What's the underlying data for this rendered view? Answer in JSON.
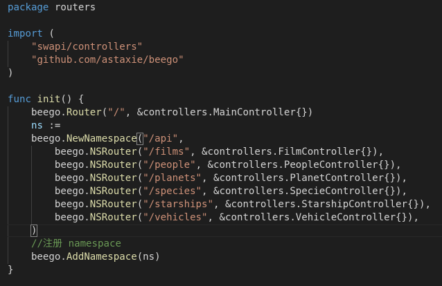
{
  "editor": {
    "lines": [
      [
        {
          "t": "package",
          "c": "kw"
        },
        {
          "t": " routers",
          "c": "plain"
        }
      ],
      [],
      [
        {
          "t": "import",
          "c": "kw"
        },
        {
          "t": " (",
          "c": "plain"
        }
      ],
      [
        {
          "t": "    ",
          "c": "plain"
        },
        {
          "t": "\"swapi/controllers\"",
          "c": "str"
        }
      ],
      [
        {
          "t": "    ",
          "c": "plain"
        },
        {
          "t": "\"github.com/astaxie/beego\"",
          "c": "str"
        }
      ],
      [
        {
          "t": ")",
          "c": "plain"
        }
      ],
      [],
      [
        {
          "t": "func",
          "c": "kw"
        },
        {
          "t": " ",
          "c": "plain"
        },
        {
          "t": "init",
          "c": "fn"
        },
        {
          "t": "() {",
          "c": "plain"
        }
      ],
      [
        {
          "t": "    beego.",
          "c": "plain"
        },
        {
          "t": "Router",
          "c": "fn"
        },
        {
          "t": "(",
          "c": "plain"
        },
        {
          "t": "\"/\"",
          "c": "str"
        },
        {
          "t": ", &controllers.MainController{})",
          "c": "plain"
        }
      ],
      [
        {
          "t": "    ",
          "c": "plain"
        },
        {
          "t": "ns",
          "c": "var"
        },
        {
          "t": " :=",
          "c": "plain"
        }
      ],
      [
        {
          "t": "    beego.",
          "c": "plain"
        },
        {
          "t": "NewNamespace",
          "c": "fn"
        },
        {
          "t": "(",
          "c": "plain",
          "m": true
        },
        {
          "t": "\"/api\"",
          "c": "str"
        },
        {
          "t": ",",
          "c": "plain"
        }
      ],
      [
        {
          "t": "        beego.",
          "c": "plain"
        },
        {
          "t": "NSRouter",
          "c": "fn"
        },
        {
          "t": "(",
          "c": "plain"
        },
        {
          "t": "\"/films\"",
          "c": "str"
        },
        {
          "t": ", &controllers.FilmController{}),",
          "c": "plain"
        }
      ],
      [
        {
          "t": "        beego.",
          "c": "plain"
        },
        {
          "t": "NSRouter",
          "c": "fn"
        },
        {
          "t": "(",
          "c": "plain"
        },
        {
          "t": "\"/people\"",
          "c": "str"
        },
        {
          "t": ", &controllers.PeopleController{}),",
          "c": "plain"
        }
      ],
      [
        {
          "t": "        beego.",
          "c": "plain"
        },
        {
          "t": "NSRouter",
          "c": "fn"
        },
        {
          "t": "(",
          "c": "plain"
        },
        {
          "t": "\"/planets\"",
          "c": "str"
        },
        {
          "t": ", &controllers.PlanetController{}),",
          "c": "plain"
        }
      ],
      [
        {
          "t": "        beego.",
          "c": "plain"
        },
        {
          "t": "NSRouter",
          "c": "fn"
        },
        {
          "t": "(",
          "c": "plain"
        },
        {
          "t": "\"/species\"",
          "c": "str"
        },
        {
          "t": ", &controllers.SpecieController{}),",
          "c": "plain"
        }
      ],
      [
        {
          "t": "        beego.",
          "c": "plain"
        },
        {
          "t": "NSRouter",
          "c": "fn"
        },
        {
          "t": "(",
          "c": "plain"
        },
        {
          "t": "\"/starships\"",
          "c": "str"
        },
        {
          "t": ", &controllers.StarshipController{}),",
          "c": "plain"
        }
      ],
      [
        {
          "t": "        beego.",
          "c": "plain"
        },
        {
          "t": "NSRouter",
          "c": "fn"
        },
        {
          "t": "(",
          "c": "plain"
        },
        {
          "t": "\"/vehicles\"",
          "c": "str"
        },
        {
          "t": ", &controllers.VehicleController{}),",
          "c": "plain"
        }
      ],
      [
        {
          "t": "    ",
          "c": "plain"
        },
        {
          "t": ")",
          "c": "plain",
          "m": true
        }
      ],
      [
        {
          "t": "    ",
          "c": "plain"
        },
        {
          "t": "//注册 namespace",
          "c": "cmt"
        }
      ],
      [
        {
          "t": "    beego.",
          "c": "plain"
        },
        {
          "t": "AddNamespace",
          "c": "fn"
        },
        {
          "t": "(ns)",
          "c": "plain"
        }
      ],
      [
        {
          "t": "}",
          "c": "plain"
        }
      ]
    ]
  },
  "colors": {
    "background": "#1e1e1e",
    "keyword": "#569cd6",
    "string": "#ce9178",
    "function": "#dcdcaa",
    "variable": "#9cdcfe",
    "comment": "#6a9955",
    "text": "#d4d4d4"
  }
}
